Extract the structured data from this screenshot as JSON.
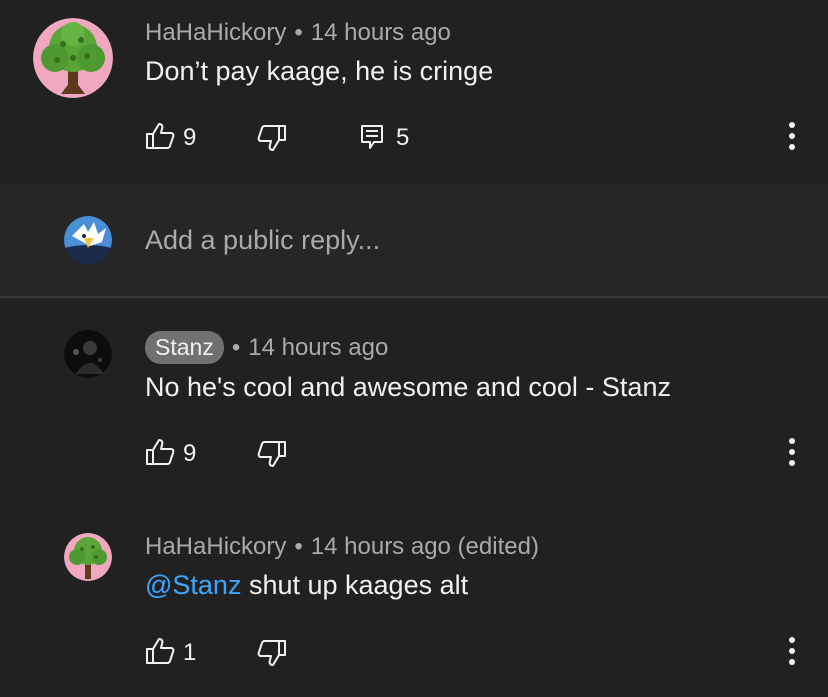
{
  "comment": {
    "author": "HaHaHickory",
    "time": "14 hours ago",
    "text": "Don’t pay kaage, he is cringe",
    "likes": "9",
    "replies": "5"
  },
  "reply_input": {
    "placeholder": "Add a public reply..."
  },
  "replies": [
    {
      "author": "Stanz",
      "time": "14 hours ago",
      "text": "No he's cool and awesome and cool - Stanz",
      "likes": "9"
    },
    {
      "author": "HaHaHickory",
      "time": "14 hours ago (edited)",
      "mention": "@Stanz",
      "text": " shut up kaages alt",
      "likes": "1"
    }
  ],
  "separator": "•",
  "icons": {
    "like": "thumbs-up-icon",
    "dislike": "thumbs-down-icon",
    "reply": "reply-icon",
    "menu": "more-vert-icon"
  },
  "colors": {
    "background": "#212121",
    "reply_box": "#262626",
    "mention": "#3ea6ff",
    "meta": "#aaaaaa"
  }
}
